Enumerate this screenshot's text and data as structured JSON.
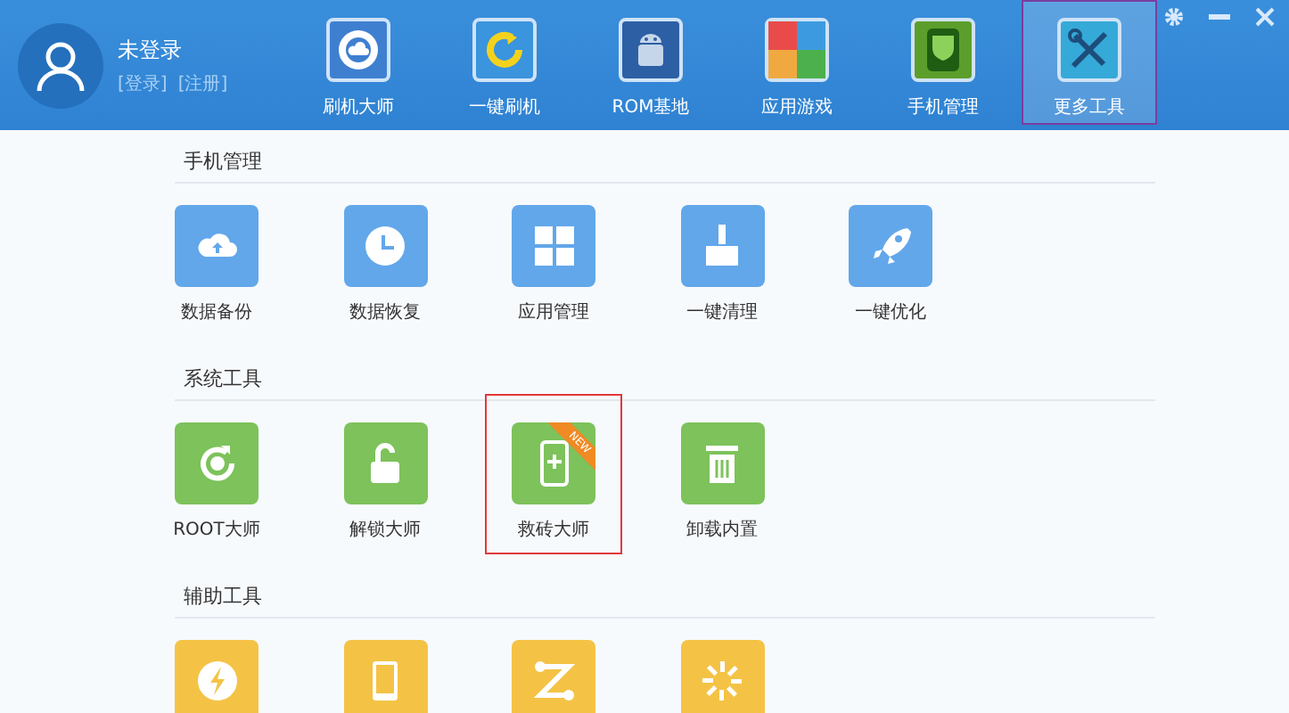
{
  "user": {
    "name": "未登录",
    "links": [
      "[登录]",
      "[注册]"
    ]
  },
  "nav": [
    {
      "label": "刷机大师",
      "selected": false
    },
    {
      "label": "一键刷机",
      "selected": false
    },
    {
      "label": "ROM基地",
      "selected": false
    },
    {
      "label": "应用游戏",
      "selected": false
    },
    {
      "label": "手机管理",
      "selected": false
    },
    {
      "label": "更多工具",
      "selected": true
    }
  ],
  "sections": [
    {
      "title": "手机管理",
      "kind": "blue",
      "tools": [
        {
          "label": "数据备份",
          "selected": false
        },
        {
          "label": "数据恢复",
          "selected": false
        },
        {
          "label": "应用管理",
          "selected": false
        },
        {
          "label": "一键清理",
          "selected": false
        },
        {
          "label": "一键优化",
          "selected": false
        }
      ]
    },
    {
      "title": "系统工具",
      "kind": "green",
      "tools": [
        {
          "label": "ROOT大师",
          "selected": false
        },
        {
          "label": "解锁大师",
          "selected": false
        },
        {
          "label": "救砖大师",
          "selected": true,
          "badge": "NEW"
        },
        {
          "label": "卸载内置",
          "selected": false
        }
      ]
    },
    {
      "title": "辅助工具",
      "kind": "yellow",
      "tools": [
        {
          "selected": false
        },
        {
          "selected": false
        },
        {
          "selected": false
        },
        {
          "selected": false
        }
      ]
    }
  ]
}
